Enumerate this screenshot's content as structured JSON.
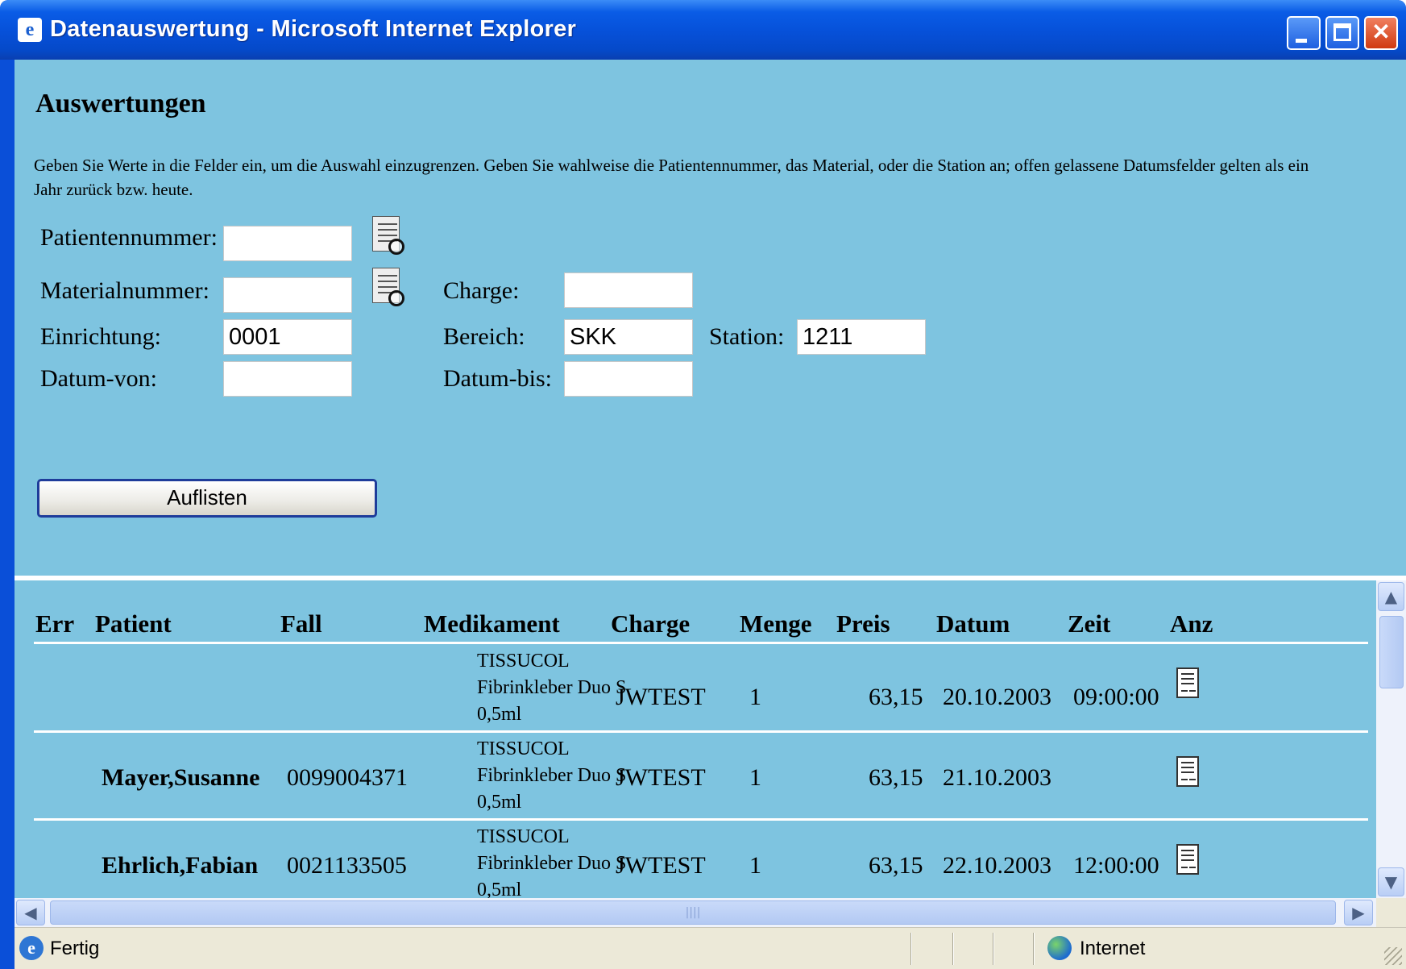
{
  "window": {
    "title": "Datenauswertung - Microsoft Internet Explorer",
    "minimize": "",
    "maximize": "",
    "close": "✕"
  },
  "form": {
    "heading": "Auswertungen",
    "description": "Geben Sie Werte in die Felder ein, um die Auswahl einzugrenzen. Geben Sie wahlweise die Patientennummer, das Material, oder die Station an; offen gelassene Datumsfelder gelten als ein Jahr zurück bzw. heute.",
    "patientennummer": {
      "label": "Patientennummer:",
      "value": ""
    },
    "materialnummer": {
      "label": "Materialnummer:",
      "value": ""
    },
    "charge": {
      "label": "Charge:",
      "value": ""
    },
    "einrichtung": {
      "label": "Einrichtung:",
      "value": "0001"
    },
    "bereich": {
      "label": "Bereich:",
      "value": "SKK"
    },
    "station": {
      "label": "Station:",
      "value": "1211"
    },
    "datum_von": {
      "label": "Datum-von:",
      "value": ""
    },
    "datum_bis": {
      "label": "Datum-bis:",
      "value": ""
    },
    "button_label": "Auflisten"
  },
  "table": {
    "headers": {
      "err": "Err",
      "patient": "Patient",
      "fall": "Fall",
      "medikament": "Medikament",
      "charge": "Charge",
      "menge": "Menge",
      "preis": "Preis",
      "datum": "Datum",
      "zeit": "Zeit",
      "anz": "Anz"
    },
    "rows": [
      {
        "err": "",
        "patient": "",
        "fall": "",
        "med1": "TISSUCOL",
        "med2": "Fibrinkleber Duo S",
        "med3": "0,5ml",
        "charge": "JWTEST",
        "menge": "1",
        "preis": "63,15",
        "datum": "20.10.2003",
        "zeit": "09:00:00"
      },
      {
        "err": "",
        "patient": "Mayer,Susanne",
        "fall": "0099004371",
        "med1": "TISSUCOL",
        "med2": "Fibrinkleber Duo S",
        "med3": "0,5ml",
        "charge": "JWTEST",
        "menge": "1",
        "preis": "63,15",
        "datum": "21.10.2003",
        "zeit": ""
      },
      {
        "err": "",
        "patient": "Ehrlich,Fabian",
        "fall": "0021133505",
        "med1": "TISSUCOL",
        "med2": "Fibrinkleber Duo S",
        "med3": "0,5ml",
        "charge": "JWTEST",
        "menge": "1",
        "preis": "63,15",
        "datum": "22.10.2003",
        "zeit": "12:00:00"
      }
    ]
  },
  "statusbar": {
    "status": "Fertig",
    "zone": "Internet"
  },
  "scrollbar": {
    "up": "▲",
    "down": "▼",
    "left": "◀",
    "right": "▶",
    "grip": "||||"
  }
}
